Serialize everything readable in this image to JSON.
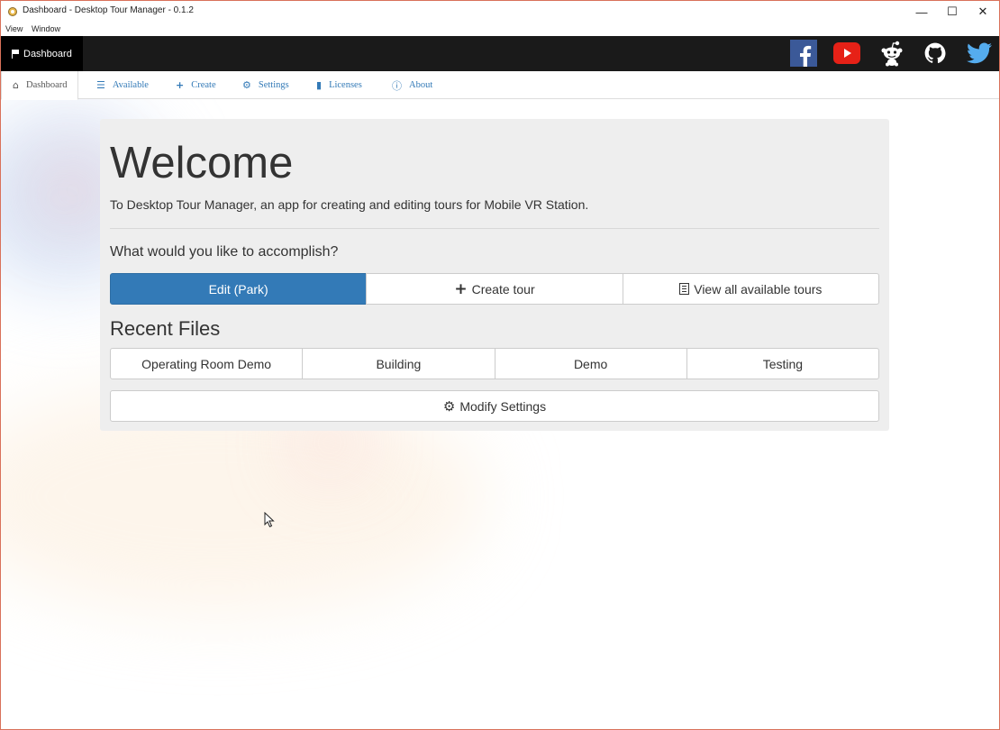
{
  "window": {
    "title": "Dashboard - Desktop Tour Manager - 0.1.2",
    "minimize_glyph": "—",
    "maximize_glyph": "☐",
    "close_glyph": "✕"
  },
  "menubar": {
    "items": [
      "View",
      "Window"
    ]
  },
  "navbar": {
    "brand_label": "Dashboard",
    "social": [
      {
        "name": "facebook-icon",
        "color": "#3b5998"
      },
      {
        "name": "youtube-icon",
        "color": "#e62117"
      },
      {
        "name": "reddit-icon",
        "color": "#ffffff"
      },
      {
        "name": "github-icon",
        "color": "#ffffff"
      },
      {
        "name": "twitter-icon",
        "color": "#55acee"
      }
    ]
  },
  "tabs": [
    {
      "label": "Dashboard",
      "icon": "home-icon",
      "active": true
    },
    {
      "label": "Available",
      "icon": "list-icon",
      "active": false
    },
    {
      "label": "Create",
      "icon": "plus-icon",
      "active": false
    },
    {
      "label": "Settings",
      "icon": "gear-icon",
      "active": false
    },
    {
      "label": "Licenses",
      "icon": "book-icon",
      "active": false
    },
    {
      "label": "About",
      "icon": "info-icon",
      "active": false
    }
  ],
  "main": {
    "heading": "Welcome",
    "intro": "To Desktop Tour Manager, an app for creating and editing tours for Mobile VR Station.",
    "question": "What would you like to accomplish?",
    "actions": {
      "edit": "Edit (Park)",
      "create": "Create tour",
      "view_all": "View all available tours"
    },
    "recent_title": "Recent Files",
    "recent_files": [
      "Operating Room Demo",
      "Building",
      "Demo",
      "Testing"
    ],
    "modify_settings": "Modify Settings"
  },
  "colors": {
    "primary": "#337ab7",
    "navbar": "#1a1a1a",
    "jumbotron": "#eeeeee",
    "link": "#337ab7"
  }
}
